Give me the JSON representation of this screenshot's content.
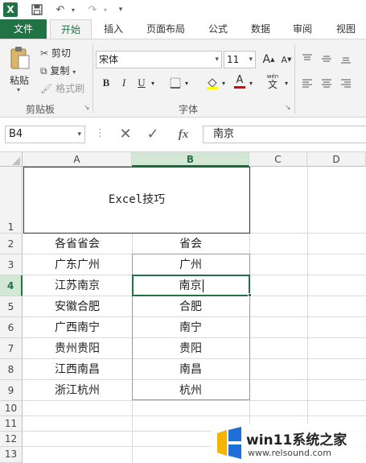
{
  "app": {
    "logo_letter": "X"
  },
  "qat": {
    "save_icon": "save-icon",
    "undo_icon": "undo-icon",
    "redo_icon": "redo-icon"
  },
  "tabs": [
    "文件",
    "开始",
    "插入",
    "页面布局",
    "公式",
    "数据",
    "审阅",
    "视图"
  ],
  "active_tab": "开始",
  "ribbon": {
    "clipboard": {
      "paste": "粘贴",
      "cut": "剪切",
      "copy": "复制",
      "format_painter": "格式刷",
      "group_label": "剪贴板"
    },
    "font": {
      "font_name": "宋体",
      "font_size": "11",
      "group_label": "字体",
      "bold": "B",
      "italic": "I",
      "underline": "U",
      "wen": "wén",
      "grow": "A",
      "shrink": "A"
    }
  },
  "formula_bar": {
    "name_box": "B4",
    "fx": "fx",
    "content": "南京"
  },
  "columns": [
    "A",
    "B",
    "C",
    "D"
  ],
  "rows": [
    "1",
    "2",
    "3",
    "4",
    "5",
    "6",
    "7",
    "8",
    "9",
    "10",
    "11",
    "12",
    "13"
  ],
  "merged_title": "Excel技巧",
  "table": {
    "header": {
      "a": "各省省会",
      "b": "省会"
    },
    "rows": [
      {
        "a": "广东广州",
        "b": "广州"
      },
      {
        "a": "江苏南京",
        "b": "南京"
      },
      {
        "a": "安徽合肥",
        "b": "合肥"
      },
      {
        "a": "广西南宁",
        "b": "南宁"
      },
      {
        "a": "贵州贵阳",
        "b": "贵阳"
      },
      {
        "a": "江西南昌",
        "b": "南昌"
      },
      {
        "a": "浙江杭州",
        "b": "杭州"
      }
    ]
  },
  "selected_cell": "B4",
  "watermark": {
    "title": "win11系统之家",
    "url": "www.relsound.com"
  },
  "colors": {
    "accent": "#217346",
    "selection": "#217346"
  }
}
